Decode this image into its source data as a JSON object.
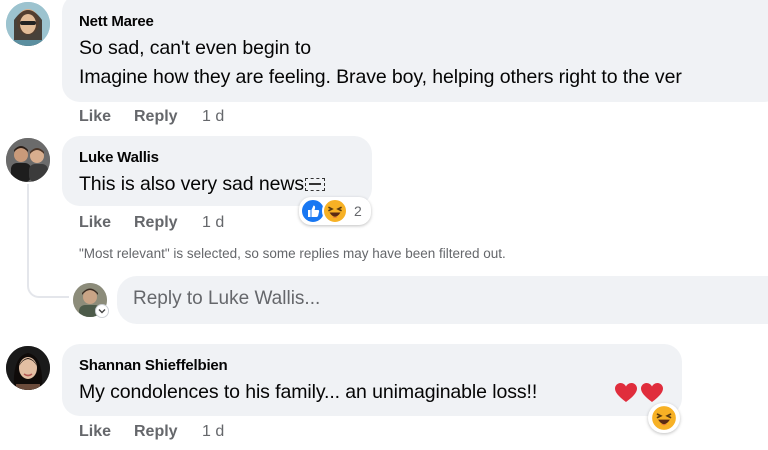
{
  "comments": [
    {
      "author": "Nett Maree",
      "text_line1": "So sad, can't even begin to",
      "text_line2": "Imagine how they are feeling. Brave boy, helping others right to the ver",
      "actions": {
        "like": "Like",
        "reply": "Reply",
        "time": "1 d"
      }
    },
    {
      "author": "Luke Wallis",
      "text": "This is also very sad news",
      "reaction_count": "2",
      "reactions": [
        "like-icon",
        "haha-icon"
      ],
      "actions": {
        "like": "Like",
        "reply": "Reply",
        "time": "1 d"
      }
    },
    {
      "author": "Shannan Shieffelbien",
      "text": "My condolences to his family... an unimaginable loss!!",
      "trailing_emoji": "❤️❤️",
      "reactions": [
        "haha-icon"
      ],
      "actions": {
        "like": "Like",
        "reply": "Reply",
        "time": "1 d"
      }
    }
  ],
  "notice": "\"Most relevant\" is selected, so some replies may have been filtered out.",
  "reply_input": {
    "placeholder": "Reply to Luke Wallis..."
  },
  "colors": {
    "bubble": "#f0f2f5",
    "secondary_text": "#65676b",
    "like_blue": "#1877f2",
    "haha_yellow": "#f7b125",
    "heart_red": "#e02d3c"
  }
}
